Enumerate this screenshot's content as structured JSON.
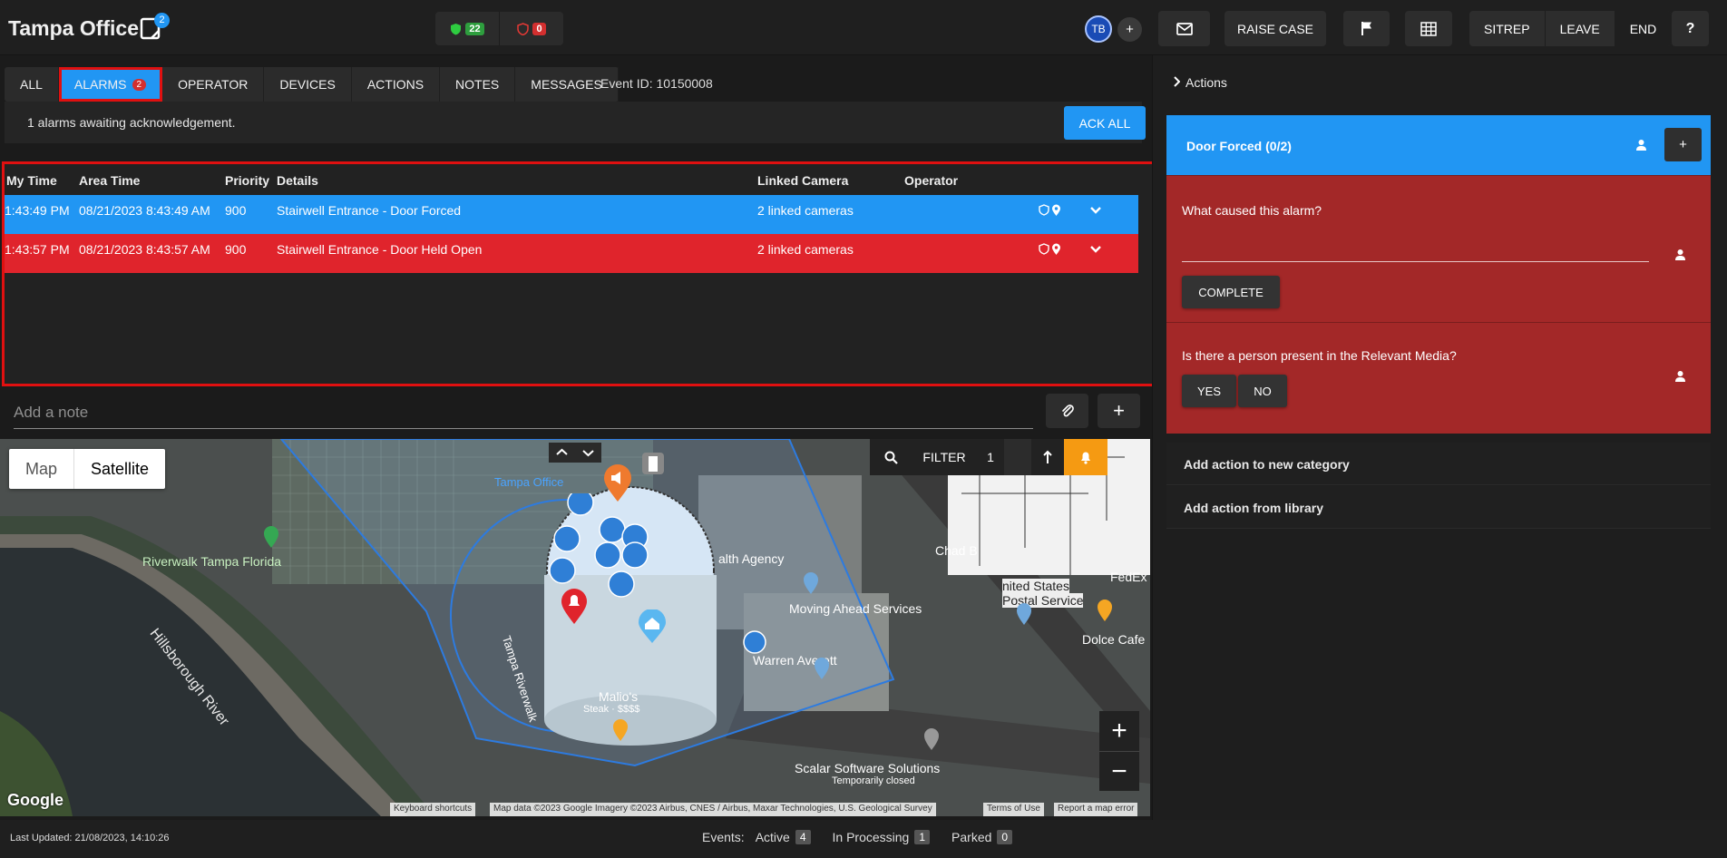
{
  "header": {
    "title": "Tampa Office",
    "notes_badge": "2",
    "status_ok_count": "22",
    "status_alert_count": "0",
    "avatar_initials": "TB",
    "avatar_add": "+",
    "raise_case_label": "RAISE CASE",
    "sitrep_label": "SITREP",
    "leave_label": "LEAVE",
    "end_label": "END",
    "help_label": "?"
  },
  "tabs": [
    {
      "label": "ALL"
    },
    {
      "label": "ALARMS",
      "badge": "2"
    },
    {
      "label": "OPERATOR"
    },
    {
      "label": "DEVICES"
    },
    {
      "label": "ACTIONS"
    },
    {
      "label": "NOTES"
    },
    {
      "label": "MESSAGES"
    }
  ],
  "event_id": "Event ID: 10150008",
  "ack": {
    "message": "1 alarms awaiting acknowledgement.",
    "button": "ACK ALL"
  },
  "alarm_table": {
    "columns": [
      "My Time",
      "Area Time",
      "Priority",
      "Details",
      "Linked Camera",
      "Operator"
    ],
    "rows": [
      {
        "my_time": "1:43:49 PM",
        "area_time": "08/21/2023 8:43:49 AM",
        "priority": "900",
        "details": "Stairwell Entrance - Door Forced",
        "linked_camera": "2 linked cameras",
        "operator": ""
      },
      {
        "my_time": "1:43:57 PM",
        "area_time": "08/21/2023 8:43:57 AM",
        "priority": "900",
        "details": "Stairwell Entrance - Door Held Open",
        "linked_camera": "2 linked cameras",
        "operator": ""
      }
    ]
  },
  "note": {
    "placeholder": "Add a note",
    "add": "+"
  },
  "map": {
    "type_map": "Map",
    "type_satellite": "Satellite",
    "filter_label": "FILTER",
    "filter_count": "1",
    "zoom_in": "+",
    "zoom_out": "−",
    "google": "Google",
    "labels": {
      "office": "Tampa Office",
      "riverwalk": "Riverwalk Tampa Florida",
      "river": "Hillsborough River",
      "health": "alth Agency",
      "moving": "Moving Ahead Services",
      "warren": "Warren Averett",
      "chad": "Chad B",
      "usps1": "nited States",
      "usps2": "Postal Service",
      "fedex": "FedEx",
      "dolce": "Dolce Cafe",
      "tampa_riverwalk": "Tampa Riverwalk",
      "malios": "Malio's",
      "malios_sub": "Steak · $$$$",
      "scalar": "Scalar Software Solutions",
      "scalar_sub": "Temporarily closed"
    },
    "attribution": {
      "shortcuts": "Keyboard shortcuts",
      "data": "Map data ©2023 Google Imagery ©2023 Airbus, CNES / Airbus, Maxar Technologies, U.S. Geological Survey",
      "terms": "Terms of Use",
      "report": "Report a map error"
    }
  },
  "footer": {
    "last_updated": "Last Updated: 21/08/2023, 14:10:26",
    "events_label": "Events:",
    "active_label": "Active",
    "active_count": "4",
    "processing_label": "In Processing",
    "processing_count": "1",
    "parked_label": "Parked",
    "parked_count": "0"
  },
  "actions_panel": {
    "heading": "Actions",
    "category_title": "Door Forced (0/2)",
    "category_add": "+",
    "q1": "What caused this alarm?",
    "q1_button": "COMPLETE",
    "q2": "Is there a person present in the Relevant Media?",
    "q2_yes": "YES",
    "q2_no": "NO",
    "add_category": "Add action to new category",
    "add_library": "Add action from library"
  },
  "colors": {
    "accent": "#2196f3",
    "alarm_red": "#e0242c",
    "action_red": "#a32828",
    "highlight": "#e01010"
  }
}
